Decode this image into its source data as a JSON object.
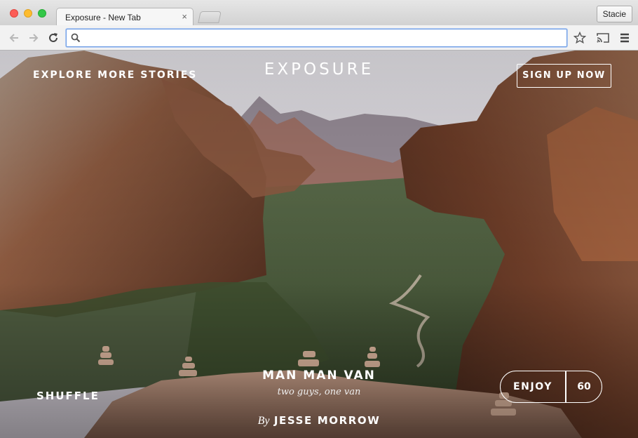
{
  "browser": {
    "tab_title": "Exposure - New Tab",
    "tab_close": "×",
    "profile_name": "Stacie",
    "address_value": "",
    "icons": [
      "back-arrow-icon",
      "forward-arrow-icon",
      "reload-icon",
      "search-icon",
      "star-icon",
      "cast-icon",
      "menu-icon"
    ]
  },
  "page": {
    "logo": "EXPOSURE",
    "explore_link": "EXPLORE MORE STORIES",
    "signup_button": "SIGN UP NOW",
    "shuffle_button": "SHUFFLE",
    "story": {
      "title": "MAN MAN VAN",
      "subtitle": "two guys, one van",
      "by": "By",
      "author": "JESSE MORROW"
    },
    "enjoy": {
      "label": "ENJOY",
      "count": "60"
    }
  },
  "colors": {
    "omnibox_border": "#6e9de4",
    "overlay_text": "#ffffff"
  }
}
